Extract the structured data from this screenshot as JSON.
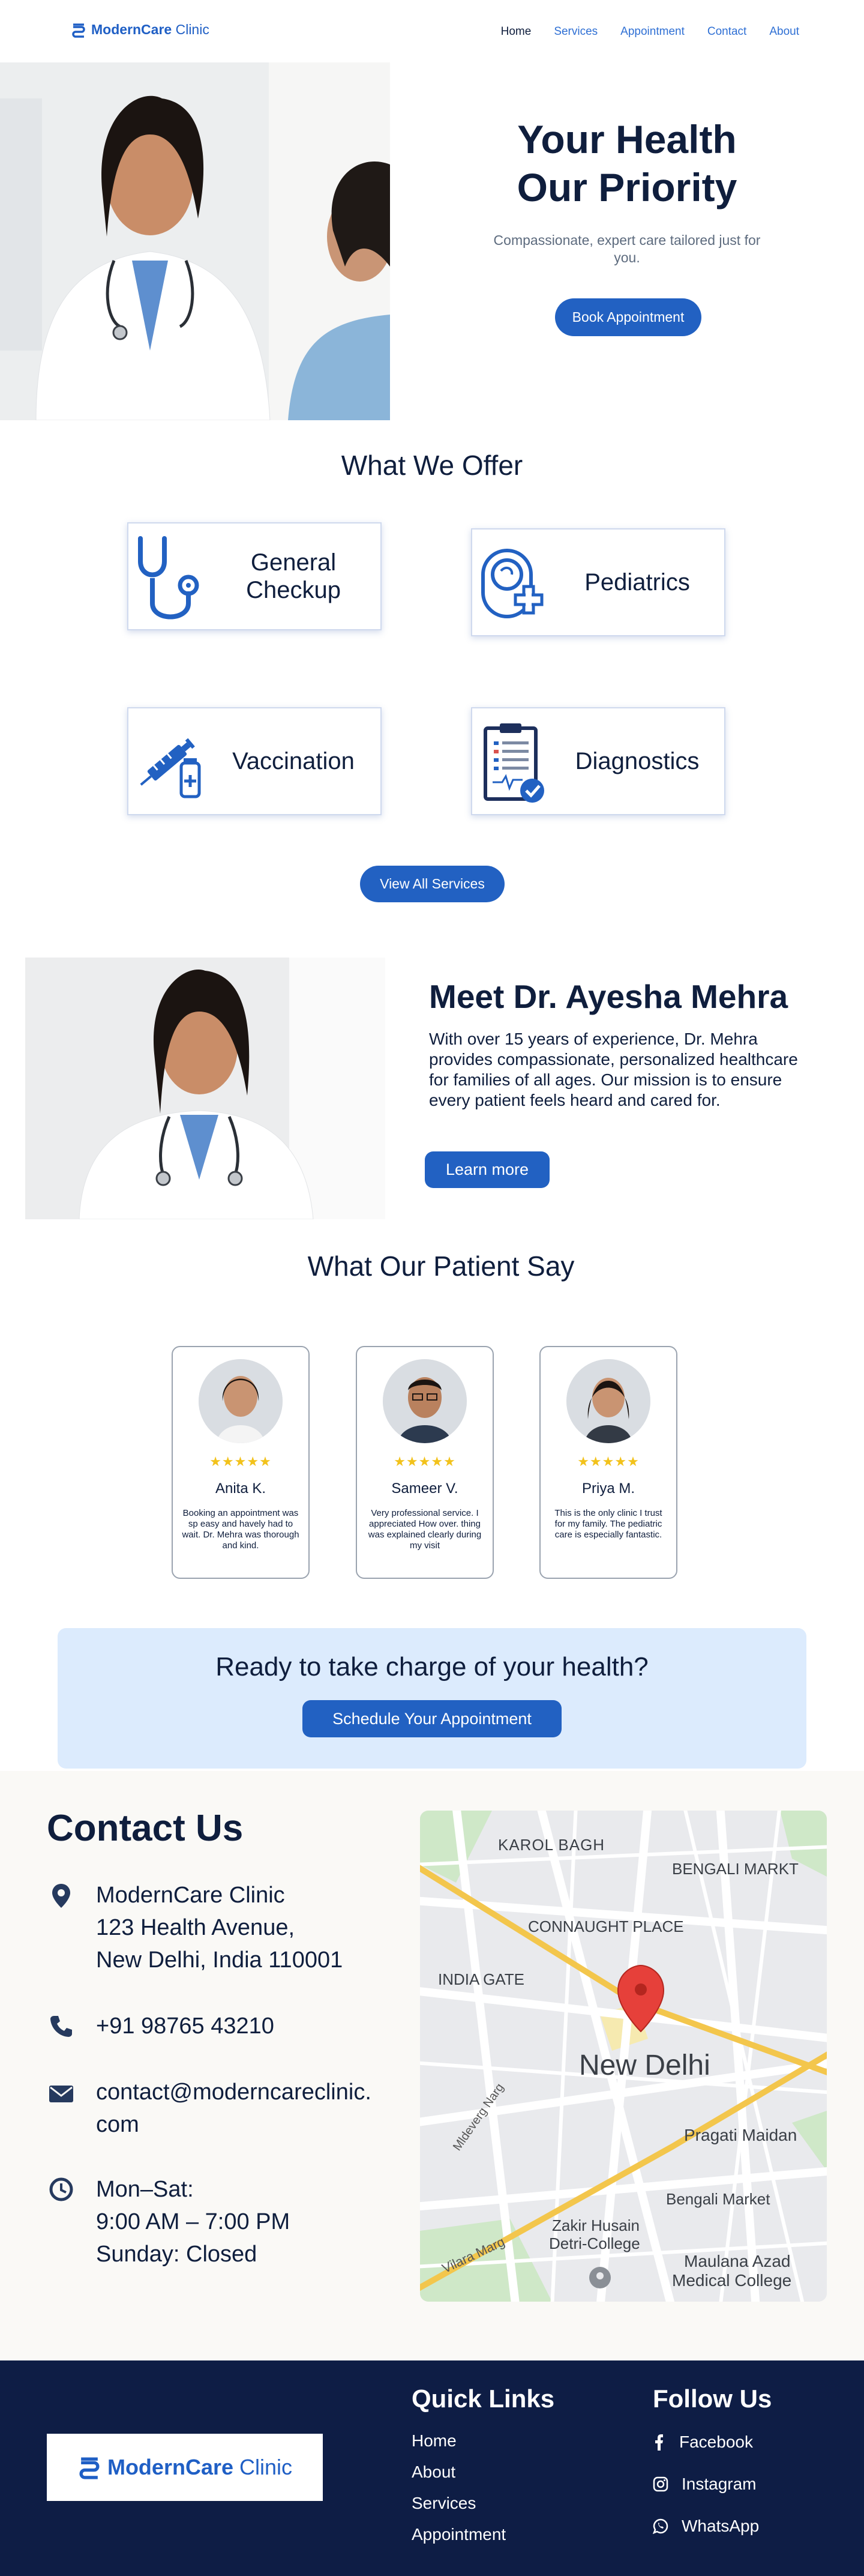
{
  "nav": {
    "brand_bold": "ModernCare",
    "brand_rest": "Clinic",
    "links": [
      "Home",
      "Services",
      "Appointment",
      "Contact",
      "About"
    ]
  },
  "hero": {
    "title_line1": "Your Health",
    "title_line2": "Our Priority",
    "subtitle": "Compassionate, expert care tailored just for you.",
    "cta": "Book Appointment"
  },
  "services": {
    "title": "What We Offer",
    "items": [
      {
        "label_line1": "General",
        "label_line2": "Checkup",
        "icon": "stethoscope-icon"
      },
      {
        "label_line1": "Pediatrics",
        "label_line2": "",
        "icon": "pediatrics-icon"
      },
      {
        "label_line1": "Vaccination",
        "label_line2": "",
        "icon": "vaccine-icon"
      },
      {
        "label_line1": "Diagnostics",
        "label_line2": "",
        "icon": "clipboard-check-icon"
      }
    ],
    "view_all": "View All Services"
  },
  "doctor": {
    "name": "Meet Dr. Ayesha Mehra",
    "bio": "With over 15 years of experience, Dr. Mehra provides compassionate, personalized healthcare for families of all ages. Our mission is to ensure every patient feels heard and cared for.",
    "cta": "Learn more"
  },
  "testimonials": {
    "title": "What Our Patient Say",
    "stars": "★★★★★",
    "items": [
      {
        "name": "Anita K.",
        "text": "Booking an appointment was  sp easy and havely had to wait. Dr. Mehra was thorough and kind."
      },
      {
        "name": "Sameer V.",
        "text": "Very professional service. I appreciated How over. thing was explained clearly during my visit"
      },
      {
        "name": "Priya M.",
        "text": "This is the only clinic I trust for my family. The pediatric care is especially fantastic."
      }
    ]
  },
  "cta_banner": {
    "title": "Ready to take charge of your health?",
    "button": "Schedule Your Appointment"
  },
  "contact": {
    "title": "Contact Us",
    "address_line1": "ModernCare Clinic",
    "address_line2": "123 Health Avenue,",
    "address_line3": "New Delhi, India  110001",
    "phone": "+91 98765 43210",
    "email_line1": "contact@moderncareclinic.",
    "email_line2": "com",
    "hours_line1": "Mon–Sat:",
    "hours_line2": "9:00 AM – 7:00 PM",
    "hours_line3": "Sunday: Closed",
    "map": {
      "city": "New Delhi",
      "labels": [
        "KAROL BAGH",
        "BENGALI MARKT",
        "CONNAUGHT PLACE",
        "INDIA GATE",
        "Mldeverg Narg",
        "Pragati Maidan",
        "Bengali Market",
        "Zakir Husain",
        "Detri-College",
        "Vilara Marg",
        "Maulana Azad",
        "Medical College"
      ]
    }
  },
  "footer": {
    "brand_bold": "ModernCare",
    "brand_rest": "Clinic",
    "quick_links_title": "Quick Links",
    "quick_links": [
      "Home",
      "About",
      "Services",
      "Appointment"
    ],
    "follow_title": "Follow Us",
    "social": [
      "Facebook",
      "Instagram",
      "WhatsApp"
    ]
  },
  "colors": {
    "primary": "#2261c2",
    "navy": "#0e1d45",
    "cta_bg": "#dcebfd",
    "star": "#f2c21b"
  }
}
